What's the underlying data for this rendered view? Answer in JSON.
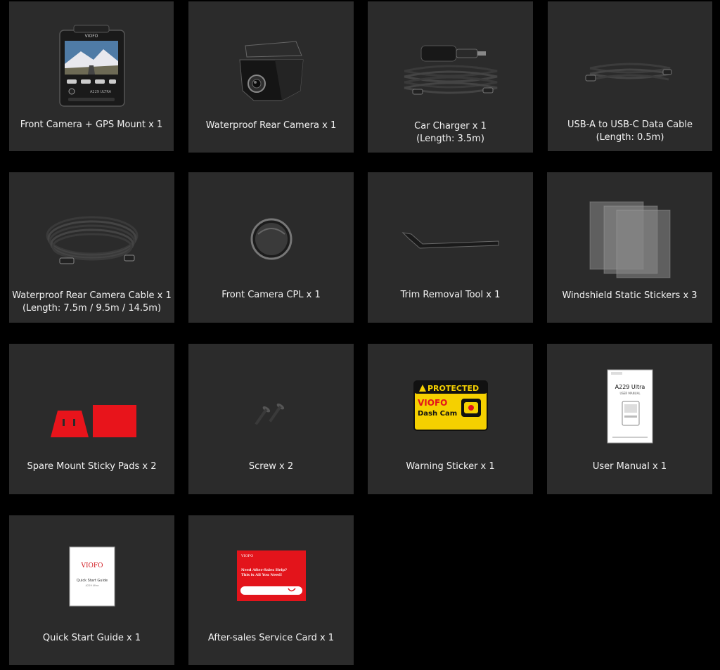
{
  "items": [
    {
      "line1": "Front Camera + GPS Mount x 1",
      "line2": ""
    },
    {
      "line1": "Waterproof Rear Camera x 1",
      "line2": ""
    },
    {
      "line1": "Car Charger x 1",
      "line2": "(Length: 3.5m)"
    },
    {
      "line1": "USB-A to USB-C Data Cable",
      "line2": "(Length: 0.5m)"
    },
    {
      "line1": "Waterproof Rear Camera Cable x 1",
      "line2": "(Length: 7.5m / 9.5m / 14.5m)"
    },
    {
      "line1": "Front Camera CPL x 1",
      "line2": ""
    },
    {
      "line1": "Trim Removal Tool x 1",
      "line2": ""
    },
    {
      "line1": "Windshield Static Stickers x 3",
      "line2": ""
    },
    {
      "line1": "Spare Mount Sticky Pads x 2",
      "line2": ""
    },
    {
      "line1": "Screw x 2",
      "line2": ""
    },
    {
      "line1": "Warning Sticker x 1",
      "line2": ""
    },
    {
      "line1": "User Manual x 1",
      "line2": ""
    },
    {
      "line1": "Quick Start Guide x 1",
      "line2": ""
    },
    {
      "line1": "After-sales Service Card x 1",
      "line2": ""
    }
  ],
  "product_text": {
    "camera_brand": "VIOFO",
    "camera_model": "A229 ULTRA",
    "sticker_top": "PROTECTED",
    "sticker_brand": "VIOFO",
    "sticker_sub": "Dash Cam",
    "manual_model": "A229 Ultra",
    "manual_title": "USER MANUAL",
    "qsg_brand": "VIOFO",
    "qsg_title": "Quick Start Guide",
    "qsg_model": "A229 Ultra",
    "card_brand": "VIOFO",
    "card_line1": "Need After-Sales Help?",
    "card_line2": "This is All You Need!"
  },
  "colors": {
    "page_bg": "#000000",
    "card_bg": "#2b2b2b",
    "text": "#f2f2f2",
    "pad_red": "#e8141b",
    "sticker_yellow": "#f5d000",
    "service_red": "#e3141b"
  }
}
